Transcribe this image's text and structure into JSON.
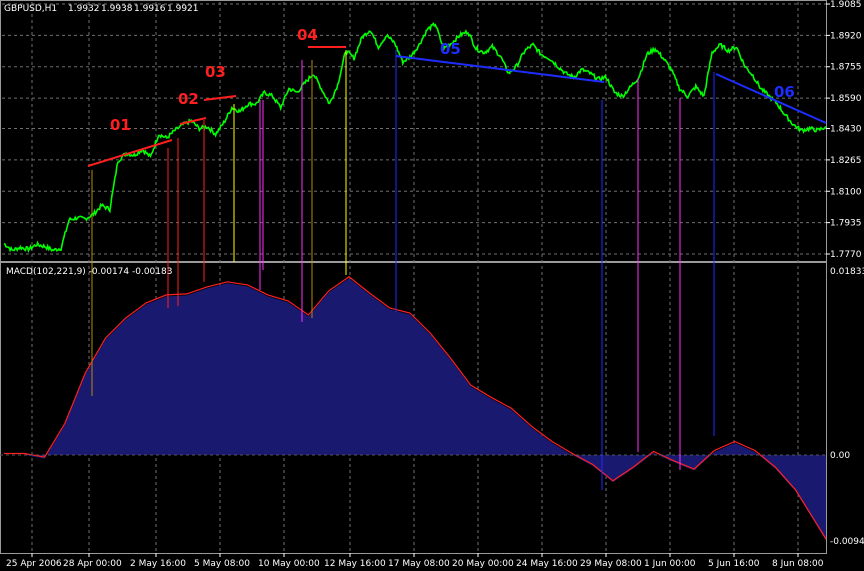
{
  "window_title": "GBPUSD,H1",
  "quote": {
    "open": "1.9932",
    "high": "1.9938",
    "low": "1.9916",
    "close": "1.9921"
  },
  "colors": {
    "background": "#000000",
    "grid": "#6f6f6f",
    "price": "#00ff00",
    "macd_fill": "#191970",
    "signal": "#ff2020",
    "red": "#ff1f1f",
    "blue": "#1e2dff",
    "magenta": "#ff30ff",
    "yellow": "#ffff00"
  },
  "chart_data": [
    {
      "type": "line",
      "title": "GBPUSD,H1",
      "series": [
        {
          "name": "GBPUSD,H1",
          "points": [
            [
              0,
              1.7825
            ],
            [
              1,
              1.779
            ],
            [
              2,
              1.7805
            ],
            [
              3,
              1.7795
            ],
            [
              4,
              1.782
            ],
            [
              5,
              1.781
            ],
            [
              6,
              1.779
            ],
            [
              7,
              1.78
            ],
            [
              8,
              1.795
            ],
            [
              9,
              1.796
            ],
            [
              10,
              1.7955
            ],
            [
              11,
              1.798
            ],
            [
              12,
              1.8025
            ],
            [
              13,
              1.8005
            ],
            [
              14,
              1.826
            ],
            [
              15,
              1.83
            ],
            [
              16,
              1.829
            ],
            [
              17,
              1.832
            ],
            [
              18,
              1.828
            ],
            [
              19,
              1.84
            ],
            [
              20,
              1.838
            ],
            [
              21,
              1.842
            ],
            [
              22,
              1.845
            ],
            [
              23,
              1.847
            ],
            [
              24,
              1.843
            ],
            [
              25,
              1.844
            ],
            [
              26,
              1.84
            ],
            [
              27,
              1.846
            ],
            [
              28,
              1.854
            ],
            [
              29,
              1.852
            ],
            [
              30,
              1.856
            ],
            [
              31,
              1.856
            ],
            [
              32,
              1.862
            ],
            [
              33,
              1.86
            ],
            [
              34,
              1.854
            ],
            [
              35,
              1.864
            ],
            [
              36,
              1.862
            ],
            [
              37,
              1.867
            ],
            [
              38,
              1.872
            ],
            [
              39,
              1.864
            ],
            [
              40,
              1.856
            ],
            [
              41,
              1.866
            ],
            [
              42,
              1.884
            ],
            [
              43,
              1.88
            ],
            [
              44,
              1.891
            ],
            [
              45,
              1.895
            ],
            [
              46,
              1.886
            ],
            [
              47,
              1.892
            ],
            [
              48,
              1.888
            ],
            [
              49,
              1.878
            ],
            [
              50,
              1.881
            ],
            [
              51,
              1.887
            ],
            [
              52,
              1.895
            ],
            [
              53,
              1.898
            ],
            [
              54,
              1.885
            ],
            [
              55,
              1.888
            ],
            [
              56,
              1.892
            ],
            [
              57,
              1.894
            ],
            [
              58,
              1.885
            ],
            [
              59,
              1.883
            ],
            [
              60,
              1.886
            ],
            [
              61,
              1.881
            ],
            [
              62,
              1.872
            ],
            [
              63,
              1.876
            ],
            [
              64,
              1.884
            ],
            [
              65,
              1.887
            ],
            [
              66,
              1.882
            ],
            [
              67,
              1.88
            ],
            [
              68,
              1.876
            ],
            [
              69,
              1.872
            ],
            [
              70,
              1.87
            ],
            [
              71,
              1.874
            ],
            [
              72,
              1.872
            ],
            [
              73,
              1.869
            ],
            [
              74,
              1.87
            ],
            [
              75,
              1.862
            ],
            [
              76,
              1.86
            ],
            [
              77,
              1.865
            ],
            [
              78,
              1.87
            ],
            [
              79,
              1.882
            ],
            [
              80,
              1.885
            ],
            [
              81,
              1.88
            ],
            [
              82,
              1.874
            ],
            [
              83,
              1.864
            ],
            [
              84,
              1.86
            ],
            [
              85,
              1.865
            ],
            [
              86,
              1.86
            ],
            [
              87,
              1.883
            ],
            [
              88,
              1.887
            ],
            [
              89,
              1.884
            ],
            [
              90,
              1.886
            ],
            [
              91,
              1.876
            ],
            [
              92,
              1.871
            ],
            [
              93,
              1.864
            ],
            [
              94,
              1.86
            ],
            [
              95,
              1.856
            ],
            [
              96,
              1.85
            ],
            [
              97,
              1.845
            ],
            [
              98,
              1.842
            ],
            [
              99,
              1.843
            ],
            [
              100,
              1.842
            ],
            [
              101,
              1.844
            ]
          ]
        }
      ],
      "ylim": [
        1.777,
        1.9085
      ],
      "y_ticks": [
        "1.9085",
        "1.8920",
        "1.8755",
        "1.8590",
        "1.8430",
        "1.8265",
        "1.8100",
        "1.7935",
        "1.7770"
      ]
    },
    {
      "type": "area",
      "title": "MACD(102,221,9) -0.00174 -0.00183",
      "series": [
        {
          "name": "MACD",
          "points": [
            [
              0,
              0.0
            ],
            [
              4,
              0.0
            ],
            [
              8,
              -0.0004
            ],
            [
              12,
              0.003
            ],
            [
              16,
              0.008
            ],
            [
              20,
              0.0115
            ],
            [
              24,
              0.0135
            ],
            [
              28,
              0.015
            ],
            [
              32,
              0.0158
            ],
            [
              36,
              0.0159
            ],
            [
              40,
              0.0166
            ],
            [
              44,
              0.0171
            ],
            [
              48,
              0.0168
            ],
            [
              52,
              0.0158
            ],
            [
              56,
              0.0152
            ],
            [
              60,
              0.0138
            ],
            [
              64,
              0.0162
            ],
            [
              68,
              0.0176
            ],
            [
              72,
              0.016
            ],
            [
              76,
              0.0145
            ],
            [
              80,
              0.014
            ],
            [
              84,
              0.012
            ],
            [
              88,
              0.0095
            ],
            [
              92,
              0.0068
            ],
            [
              96,
              0.0056
            ],
            [
              100,
              0.0045
            ],
            [
              104,
              0.0027
            ],
            [
              108,
              0.0012
            ],
            [
              112,
              0.0
            ],
            [
              116,
              -0.0012
            ],
            [
              120,
              -0.003
            ],
            [
              124,
              -0.0015
            ],
            [
              128,
              0.0002
            ],
            [
              132,
              -0.0008
            ],
            [
              136,
              -0.0017
            ],
            [
              140,
              0.0003
            ],
            [
              144,
              0.0012
            ],
            [
              148,
              0.0003
            ],
            [
              152,
              -0.0015
            ],
            [
              156,
              -0.004
            ],
            [
              160,
              -0.0076
            ],
            [
              162,
              -0.0094
            ]
          ]
        }
      ],
      "ylim": [
        -0.00946,
        0.01833
      ],
      "y_ticks": [
        "0.01833",
        "0.00",
        "-0.00946"
      ]
    }
  ],
  "x_axis_labels": [
    "25 Apr 2006",
    "28 Apr 00:00",
    "2 May 16:00",
    "5 May 08:00",
    "10 May 00:00",
    "12 May 16:00",
    "17 May 08:00",
    "20 May 00:00",
    "24 May 16:00",
    "29 May 08:00",
    "1 Jun 00:00",
    "5 Jun 16:00",
    "8 Jun 08:00"
  ],
  "annotations": [
    {
      "text": "01",
      "color": "red"
    },
    {
      "text": "02",
      "color": "red"
    },
    {
      "text": "03",
      "color": "red"
    },
    {
      "text": "04",
      "color": "red"
    },
    {
      "text": "05",
      "color": "blue"
    },
    {
      "text": "06",
      "color": "blue"
    }
  ]
}
